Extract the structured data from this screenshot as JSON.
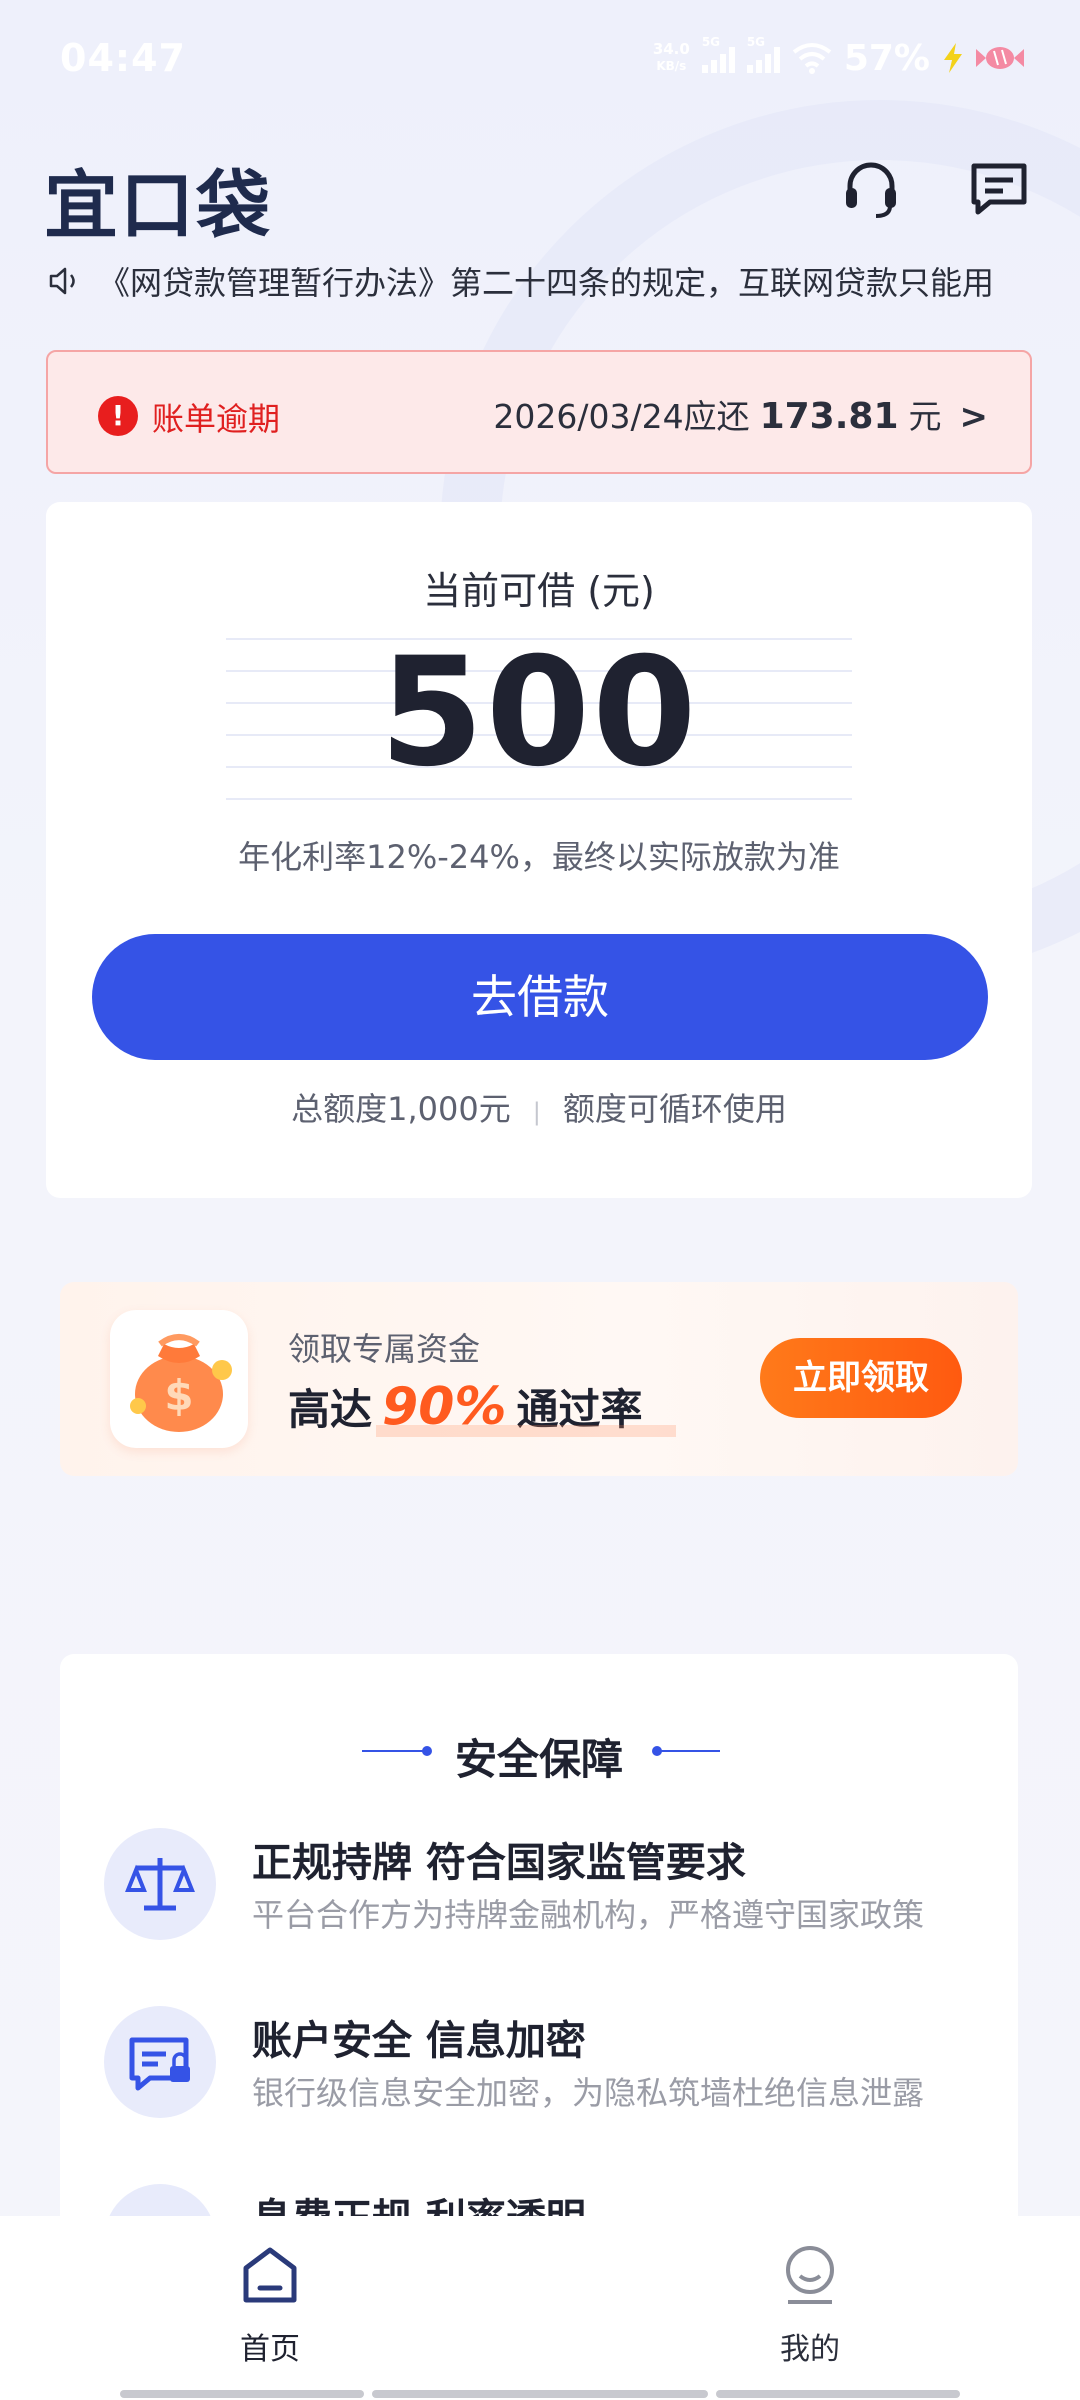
{
  "status_bar": {
    "time": "04:47",
    "net_speed_value": "34.0",
    "net_speed_unit": "KB/s",
    "sim1_label": "5G",
    "sim2_label": "5G",
    "battery_percent": "57%"
  },
  "header": {
    "logo_text": "宜口袋",
    "icons": [
      "headset-icon",
      "message-icon"
    ]
  },
  "notice": {
    "text": "《网贷款管理暂行办法》第二十四条的规定，互联网贷款只能用"
  },
  "alert": {
    "label": "账单逾期",
    "due_text": "2026/03/24应还",
    "amount": "173.81",
    "unit": "元"
  },
  "loan": {
    "available_label": "当前可借 (元)",
    "available_amount": "500",
    "rate_note": "年化利率12%-24%，最终以实际放款为准",
    "borrow_button": "去借款",
    "total_limit": "总额度1,000元",
    "recycle_note": "额度可循环使用"
  },
  "promo": {
    "subtitle": "领取专属资金",
    "prefix": "高达",
    "percent": "90%",
    "suffix": "通过率",
    "button": "立即领取"
  },
  "security": {
    "title": "安全保障",
    "items": [
      {
        "title": "正规持牌 符合国家监管要求",
        "desc": "平台合作方为持牌金融机构，严格遵守国家政策",
        "icon": "scale-icon"
      },
      {
        "title": "账户安全 信息加密",
        "desc": "银行级信息安全加密，为隐私筑墙杜绝信息泄露",
        "icon": "secure-card-icon"
      },
      {
        "title": "息费正规 利率透明",
        "icon": "document-icon"
      }
    ]
  },
  "nav": {
    "home": "首页",
    "mine": "我的"
  },
  "colors": {
    "primary": "#3553e6",
    "alert_red": "#e02020",
    "promo_orange": "#ff5a1f"
  }
}
